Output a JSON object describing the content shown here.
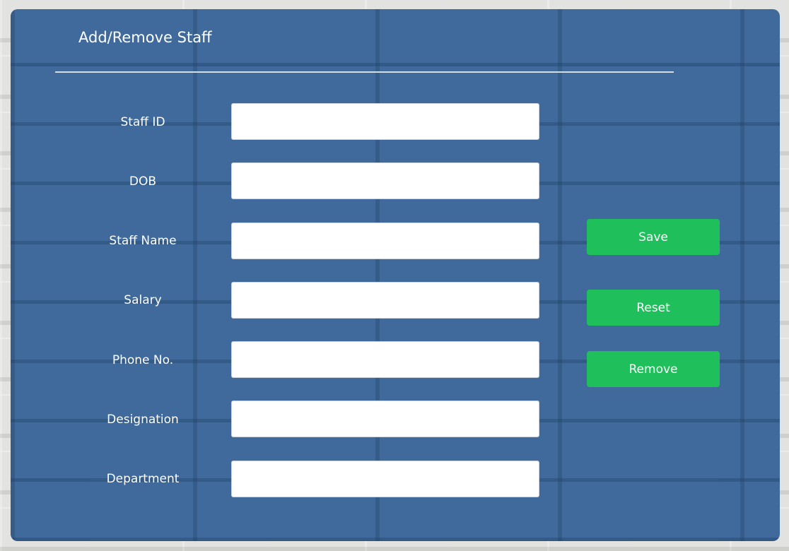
{
  "form": {
    "title": "Add/Remove Staff",
    "fields": [
      {
        "label": "Staff ID",
        "value": ""
      },
      {
        "label": "DOB",
        "value": ""
      },
      {
        "label": "Staff Name",
        "value": ""
      },
      {
        "label": "Salary",
        "value": ""
      },
      {
        "label": "Phone No.",
        "value": ""
      },
      {
        "label": "Designation",
        "value": ""
      },
      {
        "label": "Department",
        "value": ""
      }
    ],
    "buttons": {
      "save_label": "Save",
      "reset_label": "Reset",
      "remove_label": "Remove"
    }
  },
  "colors": {
    "panel": "#3f6a9b",
    "button": "#1fc05c",
    "text": "#ffffff"
  }
}
